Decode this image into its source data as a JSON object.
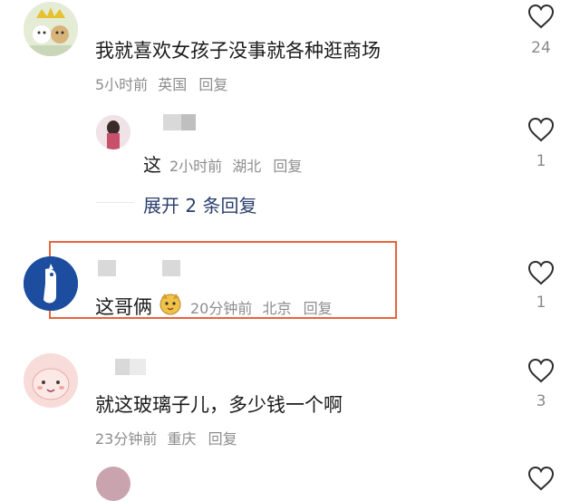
{
  "comments": [
    {
      "text": "我就喜欢女孩子没事就各种逛商场",
      "time": "5小时前",
      "location": "英国",
      "reply_label": "回复",
      "likes": "24"
    },
    {
      "text": "这",
      "time": "2小时前",
      "location": "湖北",
      "reply_label": "回复",
      "likes": "1"
    },
    {
      "text": "这哥俩",
      "time": "20分钟前",
      "location": "北京",
      "reply_label": "回复",
      "likes": "1"
    },
    {
      "text": "就这玻璃子儿，多少钱一个啊",
      "time": "23分钟前",
      "location": "重庆",
      "reply_label": "回复",
      "likes": "3"
    }
  ],
  "expand_replies": "展开 2 条回复",
  "colors": {
    "highlight_border": "#e8643c",
    "expand_text": "#2a3f6b",
    "meta_text": "#8d8d8d"
  },
  "icons": [
    "heart-outline-icon",
    "emoji-dog-icon"
  ]
}
